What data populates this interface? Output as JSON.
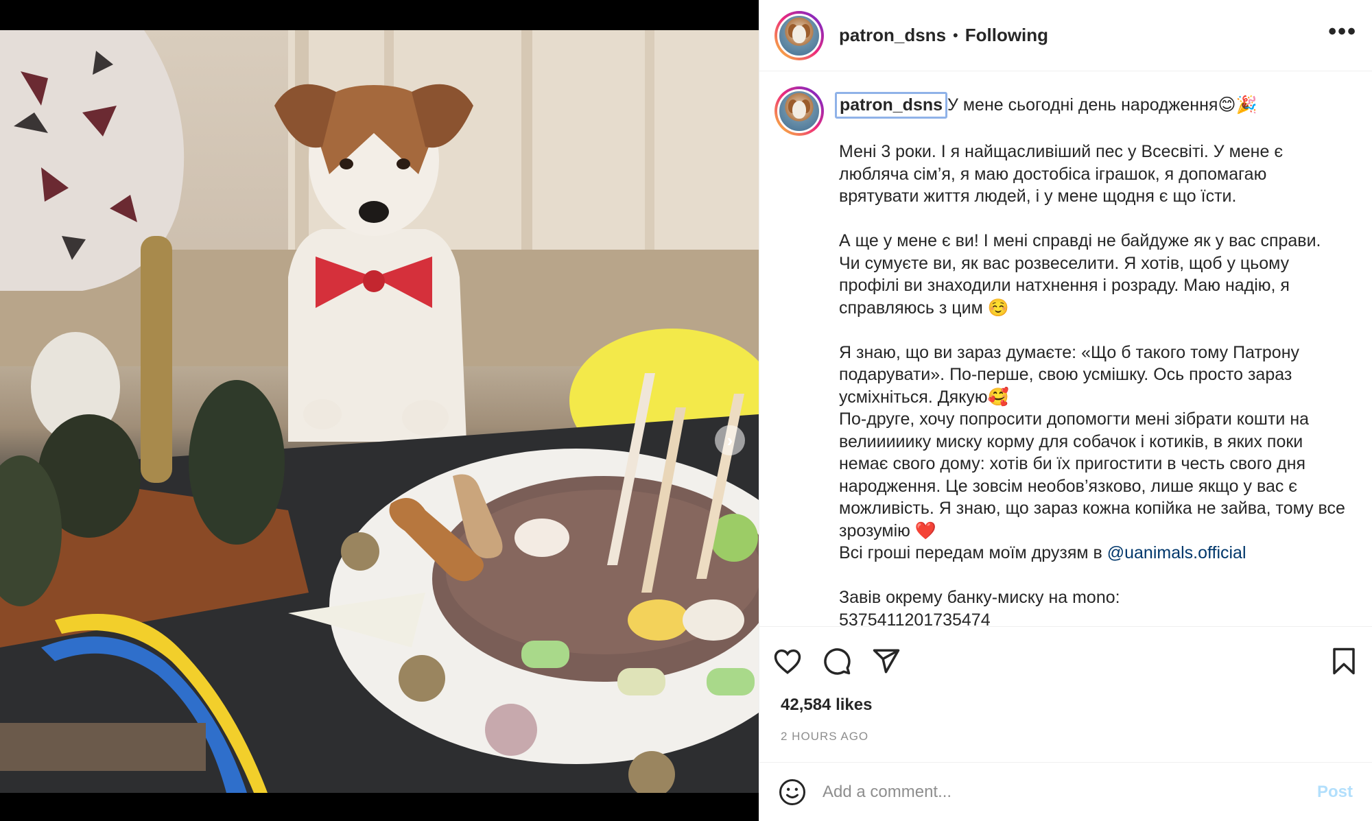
{
  "post": {
    "username": "patron_dsns",
    "separator": "•",
    "follow_status": "Following",
    "more_icon": "more-horizontal-icon"
  },
  "caption": {
    "username": "patron_dsns",
    "first_line": "У мене сьогодні день народження😊🎉",
    "p1": "Мені 3 роки. І я найщасливіший пес у Всесвіті. У мене є любляча сім’я, я маю достобіса іграшок, я допомагаю врятувати життя людей, і у мене щодня є що їсти.",
    "p2": "А ще у мене є ви! І мені справді не байдуже як у вас справи. Чи сумуєте ви, як вас розвеселити. Я хотів, щоб у цьому профілі ви знаходили натхнення і розраду. Маю надію, я справляюсь з цим ☺️",
    "p3a": "Я знаю, що ви зараз думаєте: «Що б такого тому Патрону подарувати». По-перше, свою усмішку. Ось просто зараз усміхніться. Дякую🥰",
    "p3b": "По-друге, хочу попросити допомогти мені зібрати кошти на велииииику миску корму для собачок і котиків, в яких поки немає свого дому: хотів би їх пригостити в честь свого дня народження. Це зовсім необов’язково, лише якщо у вас є можливість. Я знаю, що зараз кожна копійка не зайва, тому все зрозумію ❤️",
    "p3c_text": "Всі гроші передам моїм друзям в ",
    "p3c_mention": "@uanimals.official",
    "p4a": "Завів окрему банку-миску на mono:",
    "p4b": "5375411201735474"
  },
  "stats": {
    "likes": "42,584 likes",
    "time": "2 HOURS AGO"
  },
  "comment": {
    "placeholder": "Add a comment...",
    "post_label": "Post"
  },
  "carousel": {
    "next_glyph": "›",
    "total_slides": 2,
    "current_slide": 1
  },
  "colors": {
    "following_text": "#262626",
    "mention": "#00376b",
    "post_button_disabled": "#b2dffc",
    "secondary_text": "#8e8e8e"
  }
}
